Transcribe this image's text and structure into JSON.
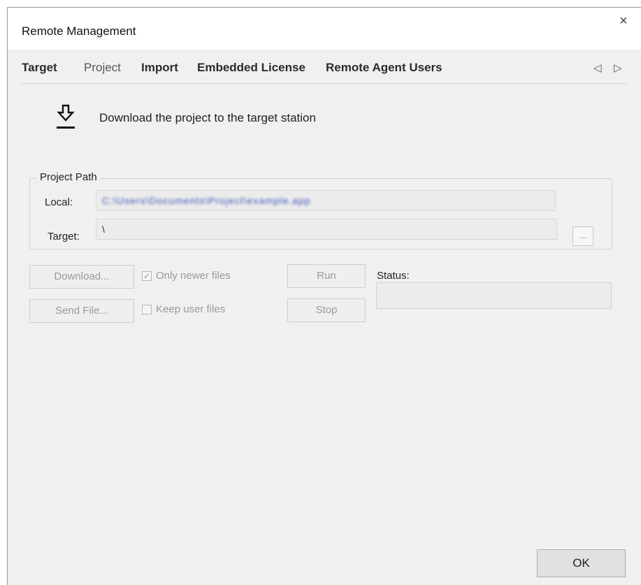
{
  "window": {
    "title": "Remote Management",
    "close_glyph": "×"
  },
  "tabs": [
    {
      "label": "Target"
    },
    {
      "label": "Project"
    },
    {
      "label": "Import"
    },
    {
      "label": "Embedded License"
    },
    {
      "label": "Remote Agent Users"
    }
  ],
  "tab_nav": {
    "prev_glyph": "◁",
    "next_glyph": "▷"
  },
  "header": {
    "icon": "download-icon",
    "text": "Download the project to the target station"
  },
  "project_path": {
    "legend": "Project Path",
    "local_label": "Local:",
    "local_value": "C:\\Users\\Documents\\Project\\example.app",
    "target_label": "Target:",
    "target_value": "\\",
    "browse_label": "..."
  },
  "actions": {
    "download_label": "Download...",
    "send_file_label": "Send File...",
    "only_newer_label": "Only newer files",
    "only_newer_checked": true,
    "keep_user_label": "Keep user files",
    "keep_user_checked": false,
    "run_label": "Run",
    "stop_label": "Stop",
    "status_label": "Status:",
    "status_value": ""
  },
  "footer": {
    "ok_label": "OK"
  }
}
